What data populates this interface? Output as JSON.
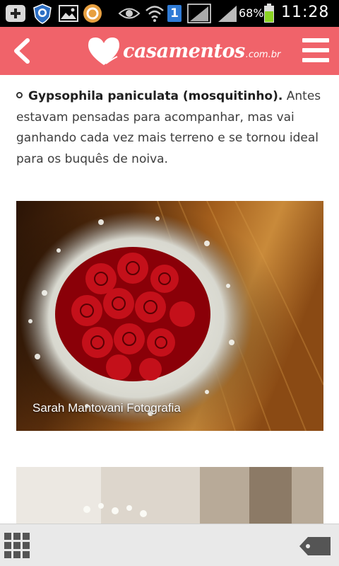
{
  "status_bar": {
    "battery": "68%",
    "time": "11:28",
    "notification_count": "1",
    "icons": [
      "add-icon",
      "shield-icon",
      "image-icon",
      "circle-app-icon",
      "eye-icon",
      "wifi-icon",
      "notification-badge-icon",
      "signal-icon",
      "signal-icon",
      "battery-icon"
    ]
  },
  "header": {
    "logo_text": "casamentos",
    "logo_suffix": ".com.br",
    "back_icon": "back-chevron-icon",
    "menu_icon": "hamburger-menu-icon",
    "brand_color": "#f0636a"
  },
  "article": {
    "item_bold": "Gypsophila paniculata (mosquitinho).",
    "item_text": " Antes estavam pensadas para acompanhar, mas vai ganhando cada vez mais terreno e se tornou ideal para os buquês de noiva.",
    "photo_caption": "Sarah Mantovani Fotografia"
  },
  "bottom_bar": {
    "left_icon": "apps-grid-icon",
    "right_icon": "tag-icon"
  }
}
